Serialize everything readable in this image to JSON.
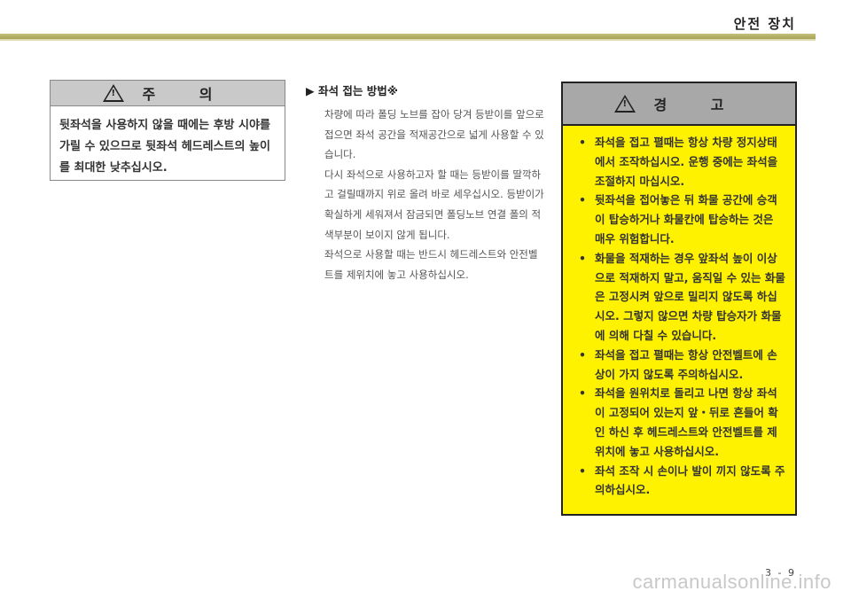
{
  "header": {
    "title": "안전 장치"
  },
  "caution": {
    "title": "주 의",
    "body": "뒷좌석을 사용하지 않을 때에는 후방 시야를 가릴 수 있으므로 뒷좌석 헤드레스트의 높이를 최대한 낮추십시오."
  },
  "section": {
    "marker": "▶",
    "title": "좌석 접는 방법※",
    "paragraphs": [
      "차량에 따라 폴딩 노브를 잡아 당겨 등받이를 앞으로 접으면 좌석 공간을 적재공간으로 넓게 사용할 수 있습니다.",
      "다시 좌석으로 사용하고자 할 때는 등받이를 딸깍하고 걸릴때까지 위로 올려 바로 세우십시오. 등받이가 확실하게 세워져서 잠금되면 폴딩노브 연결 폴의 적색부분이 보이지 않게 됩니다.",
      "좌석으로 사용할 때는 반드시 헤드레스트와 안전벨트를 제위치에 놓고 사용하십시오."
    ]
  },
  "warning": {
    "title": "경 고",
    "bullet": "•",
    "items": [
      "좌석을 접고 펼때는 항상 차량 정지상태에서 조작하십시오. 운행 중에는 좌석을 조절하지 마십시오.",
      "뒷좌석을 접어놓은 뒤 화물 공간에 승객이 탑승하거나 화물칸에 탑승하는 것은 매우 위험합니다.",
      "화물을 적재하는 경우 앞좌석 높이 이상으로 적재하지 말고, 움직일 수 있는 화물은 고정시켜 앞으로 밀리지 않도록 하십시오. 그렇지 않으면 차량 탑승자가 화물에 의해 다칠 수 있습니다.",
      "좌석을 접고 펼때는 항상 안전벨트에 손상이 가지 않도록 주의하십시오.",
      "좌석을 원위치로 돌리고 나면 항상 좌석이 고정되어 있는지 앞・뒤로 흔들어 확인 하신 후 헤드레스트와 안전벨트를 제 위치에 놓고 사용하십시오.",
      "좌석 조작 시 손이나 발이 끼지 않도록 주의하십시오."
    ]
  },
  "page_number": "3 - 9",
  "watermark": "carmanualsonline.info"
}
